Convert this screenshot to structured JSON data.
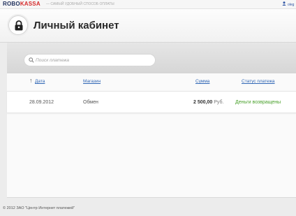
{
  "topbar": {
    "logo_part1": "ROBO",
    "logo_part2": "KASSA",
    "tagline": "— САМЫЙ УДОБНЫЙ СПОСОБ ОПЛАТЫ",
    "user_label": "oleg",
    "user_icon": "user-icon"
  },
  "header": {
    "title": "Личный кабинет",
    "icon": "lock-icon"
  },
  "search": {
    "placeholder": "Поиск платежа",
    "value": "",
    "icon": "search-icon"
  },
  "table": {
    "columns": [
      "Дата",
      "Магазин",
      "Сумма",
      "Статус платежа"
    ],
    "sort_indicator": "↑",
    "rows": [
      {
        "date": "28.09.2012",
        "shop": "Обмен",
        "amount": "2 500,00",
        "currency": "Руб.",
        "status": "Деньги возвращены"
      }
    ]
  },
  "footer": {
    "copyright": "© 2012 ЗАО \"Центр Интернет платежей\""
  },
  "colors": {
    "brand_dark": "#1f2f5c",
    "brand_red": "#d52b2b",
    "link": "#2f66b5",
    "status_ok": "#4aa12c"
  }
}
